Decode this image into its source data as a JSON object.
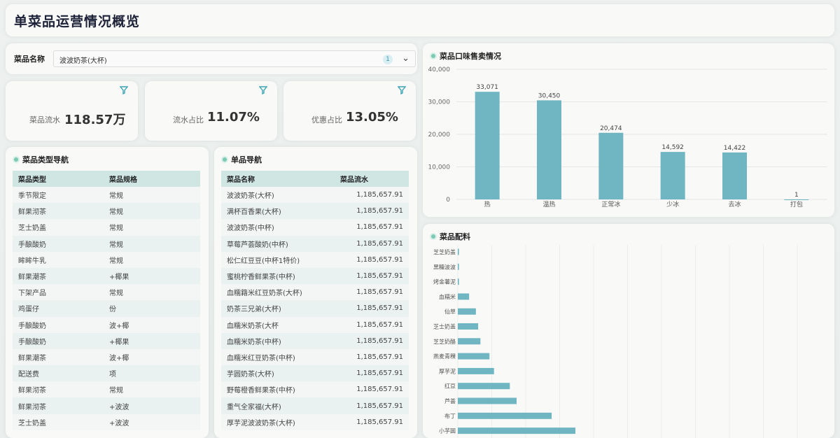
{
  "header": {
    "title": "单菜品运营情况概览"
  },
  "filter": {
    "label": "菜品名称",
    "value": "波波奶茶(大杯)",
    "count": "1"
  },
  "kpis": [
    {
      "label": "菜品流水",
      "value": "118.57万"
    },
    {
      "label": "流水占比",
      "value": "11.07%"
    },
    {
      "label": "优惠占比",
      "value": "13.05%"
    }
  ],
  "type_nav": {
    "title": "菜品类型导航",
    "columns": [
      "菜品类型",
      "菜品规格"
    ],
    "rows": [
      [
        "季节限定",
        "常规"
      ],
      [
        "鲜果沏茶",
        "常规"
      ],
      [
        "芝士奶盖",
        "常规"
      ],
      [
        "手酿酸奶",
        "常规"
      ],
      [
        "眸眸牛乳",
        "常规"
      ],
      [
        "鲜果潮茶",
        "+椰果"
      ],
      [
        "下架产品",
        "常规"
      ],
      [
        "鸡蛋仔",
        "份"
      ],
      [
        "手酿酸奶",
        "波+椰"
      ],
      [
        "手酿酸奶",
        "+椰果"
      ],
      [
        "鲜果潮茶",
        "波+椰"
      ],
      [
        "配送费",
        "项"
      ],
      [
        "鲜果沏茶",
        "常规"
      ],
      [
        "鲜果沏茶",
        "+波波"
      ],
      [
        "芝士奶盖",
        "+波波"
      ]
    ]
  },
  "item_nav": {
    "title": "单品导航",
    "columns": [
      "菜品名称",
      "菜品流水"
    ],
    "rows": [
      [
        "波波奶茶(大杯)",
        "1,185,657.91"
      ],
      [
        "满杯百香果(大杯)",
        "1,185,657.91"
      ],
      [
        "波波奶茶(中杯)",
        "1,185,657.91"
      ],
      [
        "草莓芦荟酸奶(中杯)",
        "1,185,657.91"
      ],
      [
        "松仁红豆豆(中杯1特价)",
        "1,185,657.91"
      ],
      [
        "蜜桃柠香鲜果茶(中杯)",
        "1,185,657.91"
      ],
      [
        "血糯籍米红豆奶茶(大杯)",
        "1,185,657.91"
      ],
      [
        "奶茶三兄弟(大杯)",
        "1,185,657.91"
      ],
      [
        "血糯米奶茶(大杯",
        "1,185,657.91"
      ],
      [
        "血糯米奶茶(中杯)",
        "1,185,657.91"
      ],
      [
        "血糯米红豆奶茶(中杯)",
        "1,185,657.91"
      ],
      [
        "芋圆奶茶(大杯)",
        "1,185,657.91"
      ],
      [
        "野莓橙香鲜果茶(中杯)",
        "1,185,657.91"
      ],
      [
        "重气全家福(大杯)",
        "1,185,657.91"
      ],
      [
        "厚芋泥波波奶茶(大杯)",
        "1,185,657.91"
      ]
    ]
  },
  "chart_data": [
    {
      "type": "bar",
      "title": "菜品口味售卖情况",
      "categories": [
        "热",
        "温热",
        "正常冰",
        "少冰",
        "去冰",
        "打包"
      ],
      "values": [
        33071,
        30450,
        20474,
        14592,
        14422,
        1
      ],
      "value_labels": [
        "33,071",
        "30,450",
        "20,474",
        "14,592",
        "14,422",
        "1"
      ],
      "ylim": [
        0,
        40000
      ],
      "yticks": [
        "0",
        "10,000",
        "20,000",
        "30,000",
        "40,000"
      ],
      "grid": true,
      "color": "#6fb5c2"
    },
    {
      "type": "bar",
      "orientation": "horizontal",
      "title": "菜品配料",
      "categories": [
        "芝芝奶盖",
        "黑糖波波",
        "烤金薯泥",
        "血糯米",
        "仙草",
        "芝士奶盖",
        "芝芝奶酪",
        "燕麦青稞",
        "厚芋泥",
        "红豆",
        "芦荟",
        "布丁",
        "小芋圆"
      ],
      "values": [
        1,
        1,
        1,
        10,
        16,
        18,
        20,
        28,
        32,
        46,
        52,
        83,
        104
      ],
      "color": "#6fb5c2"
    }
  ]
}
